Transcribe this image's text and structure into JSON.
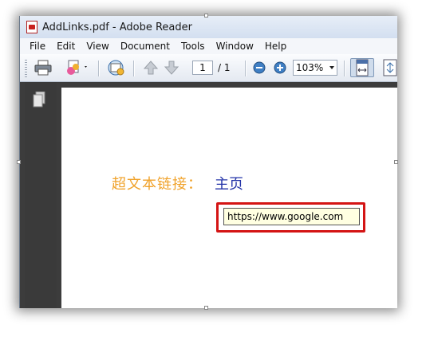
{
  "window": {
    "title": "AddLinks.pdf - Adobe Reader"
  },
  "menu": {
    "items": [
      "File",
      "Edit",
      "View",
      "Document",
      "Tools",
      "Window",
      "Help"
    ]
  },
  "toolbar": {
    "page_number": "1",
    "page_total": "/ 1",
    "zoom": "103%",
    "icons": [
      "print-icon",
      "share-icon",
      "cloud-icon",
      "previous-page-icon",
      "next-page-icon",
      "zoom-out-icon",
      "zoom-in-icon",
      "fit-width-icon",
      "fit-page-icon"
    ]
  },
  "document": {
    "link_label": "超文本链接：",
    "link_text": "主页",
    "tooltip_url": "https://www.google.com"
  },
  "colors": {
    "label": "#f0a22a",
    "link": "#2333a8",
    "highlight": "#d41414",
    "tooltip_bg": "#ffffe1"
  }
}
